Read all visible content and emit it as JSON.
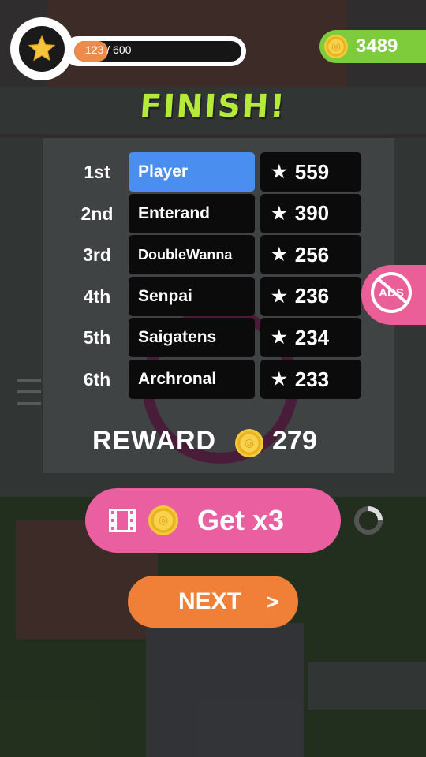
{
  "hud": {
    "progress_current": "123",
    "progress_total": "/ 600",
    "progress_fraction": 0.205,
    "coins": "3489"
  },
  "title": "FINISH!",
  "leaderboard": [
    {
      "rank": "1st",
      "name": "Player",
      "score": "559",
      "highlight": true
    },
    {
      "rank": "2nd",
      "name": "Enterand",
      "score": "390",
      "highlight": false
    },
    {
      "rank": "3rd",
      "name": "DoubleWanna",
      "score": "256",
      "highlight": false
    },
    {
      "rank": "4th",
      "name": "Senpai",
      "score": "236",
      "highlight": false
    },
    {
      "rank": "5th",
      "name": "Saigatens",
      "score": "234",
      "highlight": false
    },
    {
      "rank": "6th",
      "name": "Archronal",
      "score": "233",
      "highlight": false
    }
  ],
  "ads_badge": {
    "text": "ADS"
  },
  "reward": {
    "label": "REWARD",
    "value": "279"
  },
  "buttons": {
    "multiplier": "Get x3",
    "next": "NEXT",
    "next_arrow": ">"
  },
  "colors": {
    "title": "#b5ea38",
    "player_highlight": "#4a8ef0",
    "coin_pill": "#7ecb3c",
    "get_x3_button": "#ea5fa0",
    "next_button": "#f07f38",
    "progress_fill": "#ee8a4a"
  },
  "icons": {
    "level": "star-icon",
    "currency": "coin-icon",
    "score": "star-icon",
    "video": "film-icon",
    "ads": "no-ads-icon",
    "loading": "spinner-icon"
  }
}
